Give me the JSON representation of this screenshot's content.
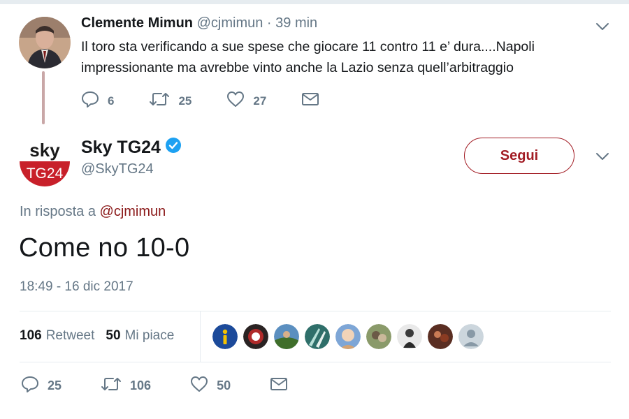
{
  "reply_tweet": {
    "author_name": "Clemente Mimun",
    "author_handle": "@cjmimun",
    "time_ago": "· 39 min",
    "text": "Il toro sta verificando a sue spese che giocare  11 contro 11 e’ dura....Napoli impressionante ma avrebbe vinto anche la Lazio senza quell’arbitraggio",
    "replies": "6",
    "retweets": "25",
    "likes": "27"
  },
  "main_tweet": {
    "author_name": "Sky TG24",
    "author_handle": "@SkyTG24",
    "logo_text_top": "sky",
    "logo_text_bottom": "TG24",
    "follow_label": "Segui",
    "in_reply_prefix": "In risposta a",
    "in_reply_handle": "@cjmimun",
    "text": "Come no 10-0",
    "timestamp": "18:49 - 16 dic 2017",
    "retweet_count": "106",
    "retweet_label": "Retweet",
    "like_count": "50",
    "like_label": "Mi piace",
    "replies": "25",
    "retweets": "106",
    "likes": "50"
  },
  "icons": [
    "reply-icon",
    "retweet-icon",
    "like-icon",
    "message-icon",
    "verified-icon",
    "chevron-down-icon"
  ],
  "colors": {
    "accent": "#a21c24",
    "muted": "#657786",
    "text": "#14171a",
    "verified": "#1da1f2"
  }
}
